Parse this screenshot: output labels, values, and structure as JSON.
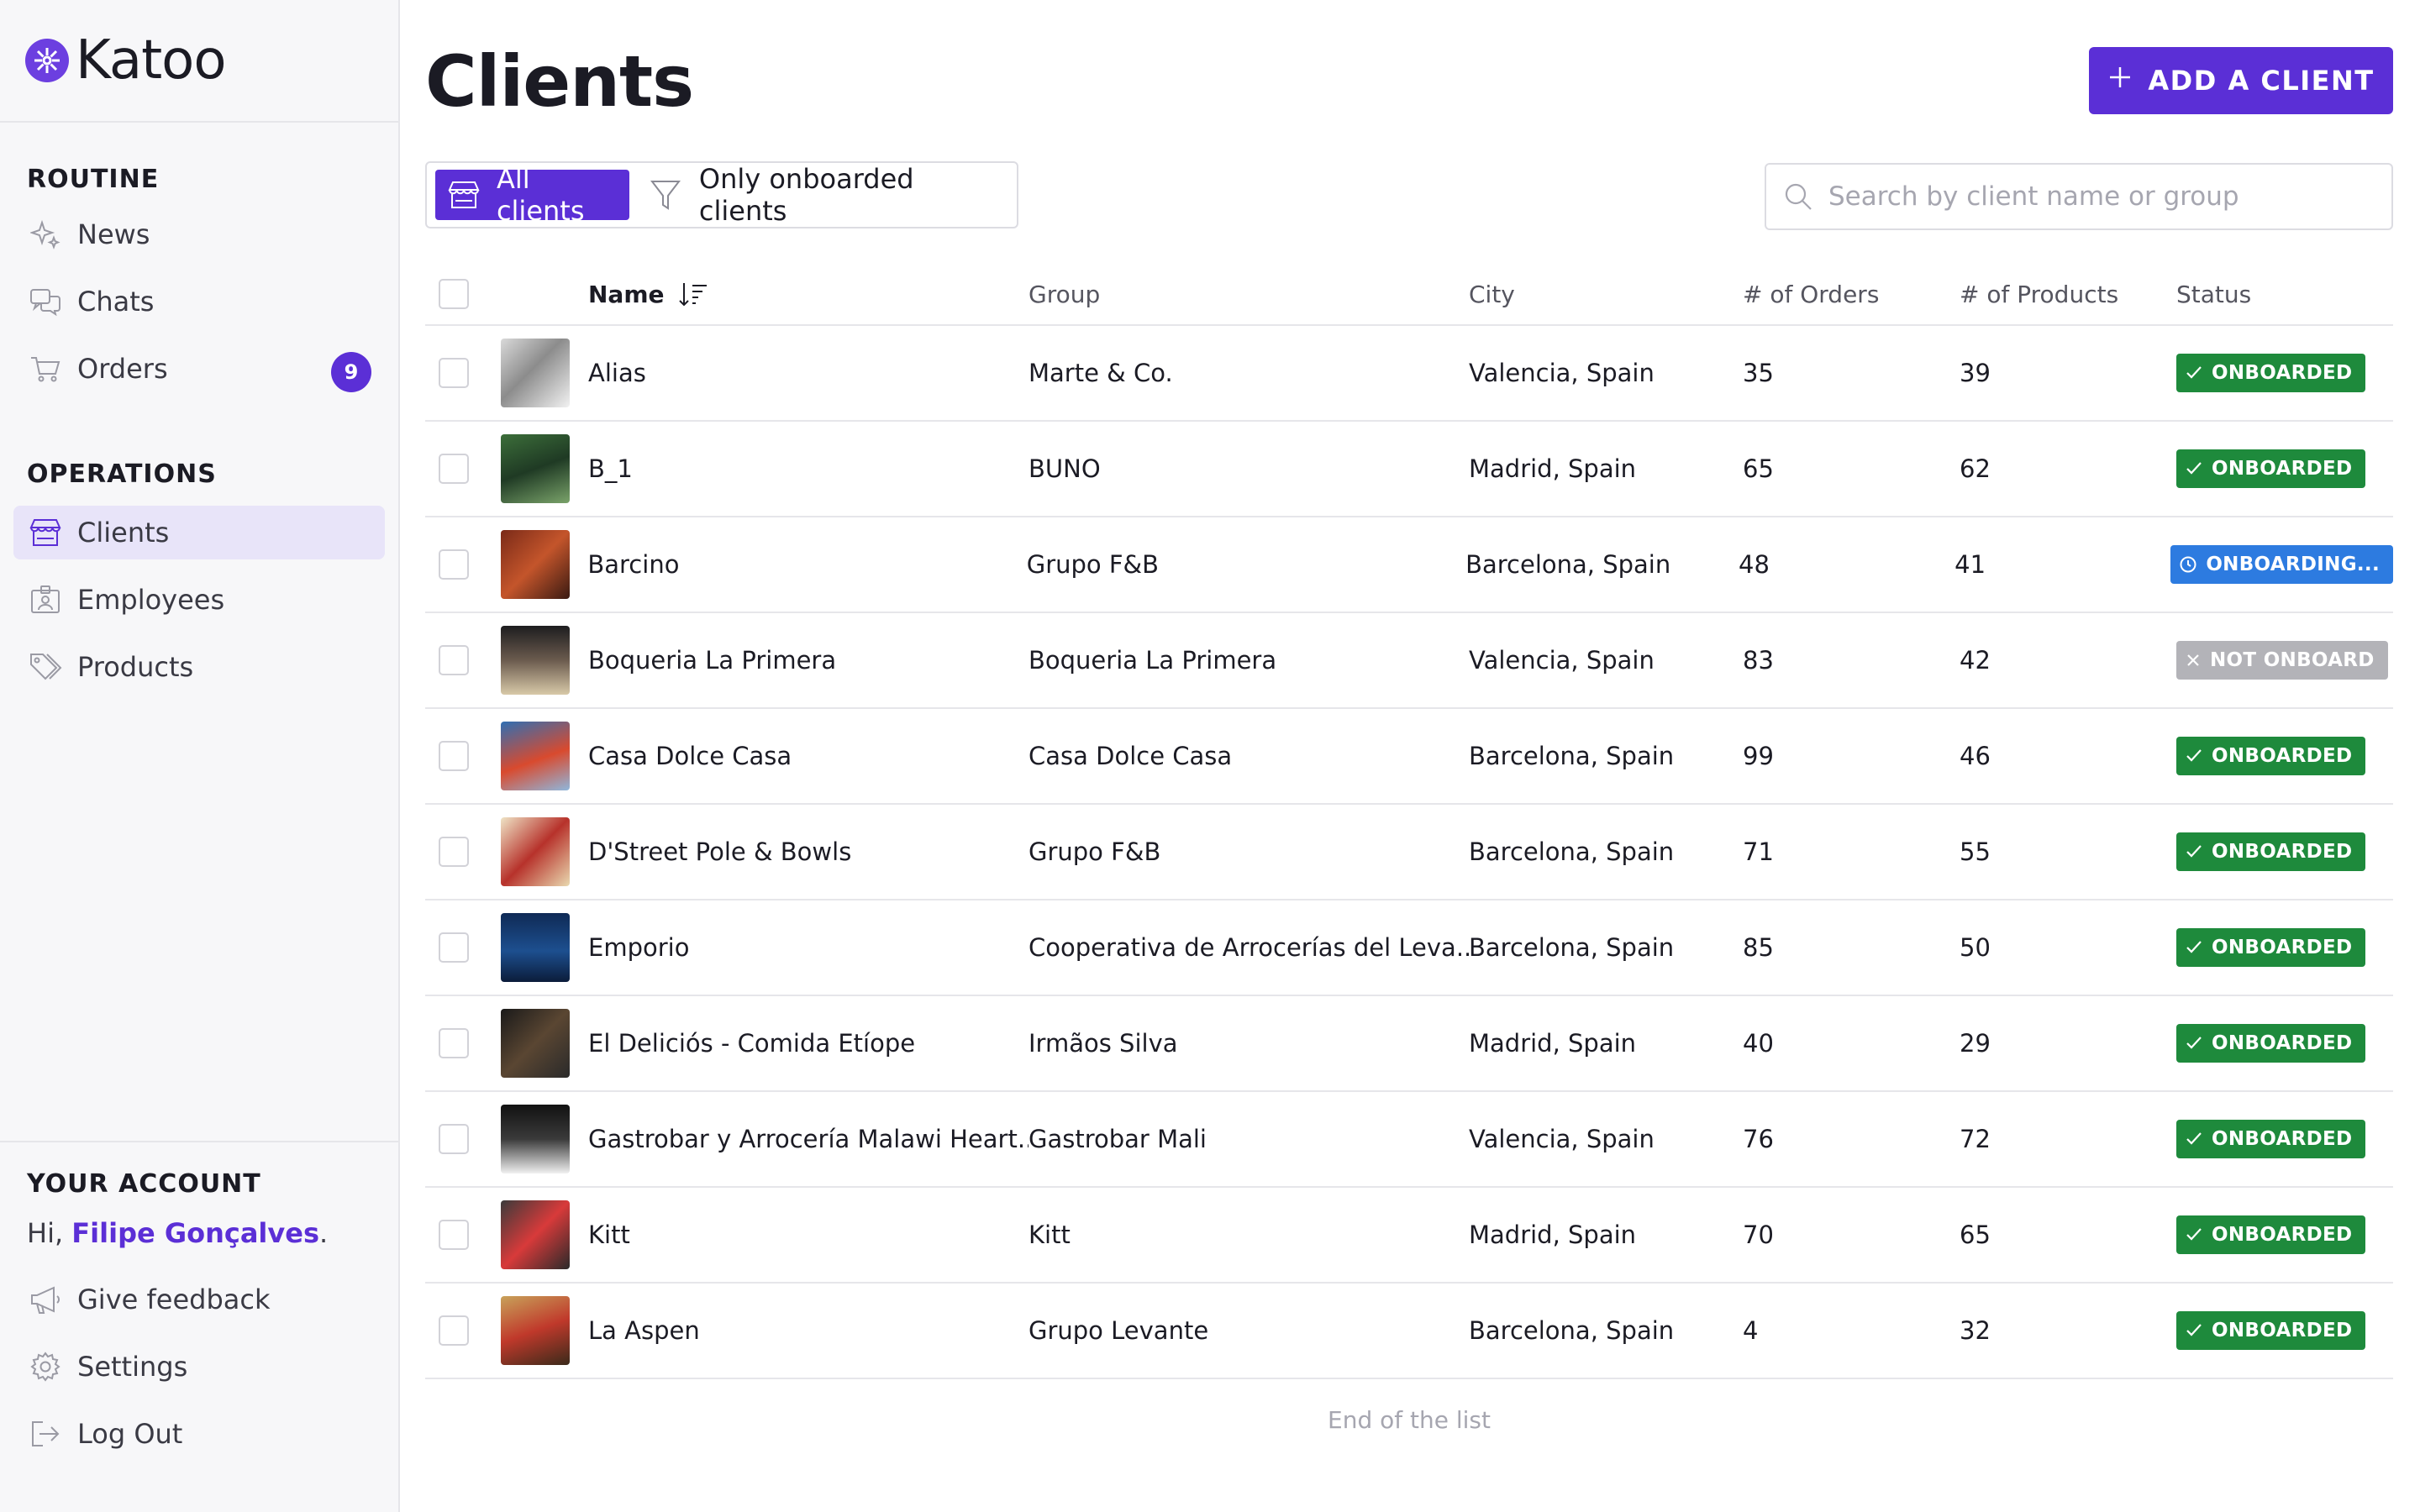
{
  "app": {
    "brand": "Katoo"
  },
  "sidebar": {
    "routine_title": "ROUTINE",
    "routine_items": [
      {
        "label": "News",
        "icon": "sparkles-icon"
      },
      {
        "label": "Chats",
        "icon": "chat-bubbles-icon"
      },
      {
        "label": "Orders",
        "icon": "cart-icon",
        "badge": "9"
      }
    ],
    "operations_title": "OPERATIONS",
    "operations_items": [
      {
        "label": "Clients",
        "icon": "store-icon",
        "active": true
      },
      {
        "label": "Employees",
        "icon": "id-badge-icon"
      },
      {
        "label": "Products",
        "icon": "tags-icon"
      }
    ],
    "account_title": "YOUR ACCOUNT",
    "greeting_prefix": "Hi, ",
    "user_name": "Filipe Gonçalves",
    "greeting_suffix": ".",
    "account_items": [
      {
        "label": "Give feedback",
        "icon": "megaphone-icon"
      },
      {
        "label": "Settings",
        "icon": "gear-icon"
      },
      {
        "label": "Log Out",
        "icon": "logout-icon"
      }
    ]
  },
  "main": {
    "title": "Clients",
    "add_button": "ADD A CLIENT",
    "filters": {
      "all": "All clients",
      "onboarded": "Only onboarded clients",
      "selected": "all"
    },
    "search": {
      "placeholder": "Search by client name or group",
      "value": ""
    },
    "columns": [
      "Name",
      "Group",
      "City",
      "# of Orders",
      "# of Products",
      "Status"
    ],
    "rows": [
      {
        "name": "Alias",
        "group": "Marte & Co.",
        "city": "Valencia, Spain",
        "orders": "35",
        "products": "39",
        "status": "ONBOARDED",
        "status_type": "onboarded"
      },
      {
        "name": "B_1",
        "group": "BUNO",
        "city": "Madrid, Spain",
        "orders": "65",
        "products": "62",
        "status": "ONBOARDED",
        "status_type": "onboarded"
      },
      {
        "name": "Barcino",
        "group": "Grupo F&B",
        "city": "Barcelona, Spain",
        "orders": "48",
        "products": "41",
        "status": "ONBOARDING...",
        "status_type": "onboarding"
      },
      {
        "name": "Boqueria La Primera",
        "group": "Boqueria La Primera",
        "city": "Valencia, Spain",
        "orders": "83",
        "products": "42",
        "status": "NOT ONBOARD",
        "status_type": "not_onboard"
      },
      {
        "name": "Casa Dolce Casa",
        "group": "Casa Dolce Casa",
        "city": "Barcelona, Spain",
        "orders": "99",
        "products": "46",
        "status": "ONBOARDED",
        "status_type": "onboarded"
      },
      {
        "name": "D'Street Pole & Bowls",
        "group": "Grupo F&B",
        "city": "Barcelona, Spain",
        "orders": "71",
        "products": "55",
        "status": "ONBOARDED",
        "status_type": "onboarded"
      },
      {
        "name": "Emporio",
        "group": "Cooperativa de Arrocerías del Leva...",
        "city": "Barcelona, Spain",
        "orders": "85",
        "products": "50",
        "status": "ONBOARDED",
        "status_type": "onboarded"
      },
      {
        "name": "El Deliciós - Comida Etíope",
        "group": "Irmãos Silva",
        "city": "Madrid, Spain",
        "orders": "40",
        "products": "29",
        "status": "ONBOARDED",
        "status_type": "onboarded"
      },
      {
        "name": "Gastrobar y Arrocería Malawi Heart...",
        "group": "Gastrobar Mali",
        "city": "Valencia, Spain",
        "orders": "76",
        "products": "72",
        "status": "ONBOARDED",
        "status_type": "onboarded"
      },
      {
        "name": "Kitt",
        "group": "Kitt",
        "city": "Madrid, Spain",
        "orders": "70",
        "products": "65",
        "status": "ONBOARDED",
        "status_type": "onboarded"
      },
      {
        "name": "La Aspen",
        "group": "Grupo Levante",
        "city": "Barcelona, Spain",
        "orders": "4",
        "products": "32",
        "status": "ONBOARDED",
        "status_type": "onboarded"
      }
    ],
    "end_of_list": "End of the list"
  },
  "colors": {
    "brand": "#5b2fd6",
    "onboarded": "#1e8a3c",
    "onboarding": "#2d7be0",
    "not_onboard": "#b3b3b8",
    "sidebar_bg": "#f7f7f9",
    "active_bg": "#e8e4f9"
  }
}
